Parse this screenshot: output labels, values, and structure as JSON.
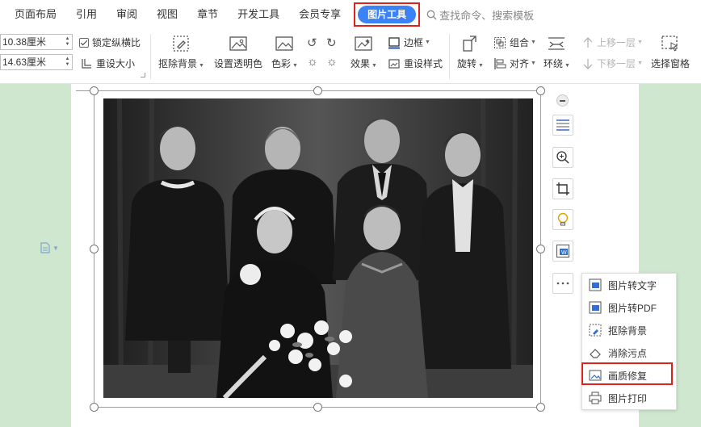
{
  "menu": {
    "items": [
      "页面布局",
      "引用",
      "审阅",
      "视图",
      "章节",
      "开发工具",
      "会员专享"
    ],
    "active_tab": "图片工具",
    "search_label": "查找命令、搜索模板"
  },
  "ribbon": {
    "width_value": "10.38厘米",
    "height_value": "14.63厘米",
    "lock_ratio_label": "锁定纵横比",
    "reset_size_label": "重设大小",
    "remove_bg_label": "抠除背景",
    "transparency_label": "设置透明色",
    "color_label": "色彩",
    "effects_label": "效果",
    "border_label": "边框",
    "reset_style_label": "重设样式",
    "rotate_label": "旋转",
    "group_label": "组合",
    "align_label": "对齐",
    "wrap_label": "环绕",
    "bring_forward_label": "上移一层",
    "send_backward_label": "下移一层",
    "selection_pane_label": "选择窗格"
  },
  "context_menu": {
    "items": [
      {
        "label": "图片转文字",
        "icon": "image-to-text-icon"
      },
      {
        "label": "图片转PDF",
        "icon": "image-to-pdf-icon"
      },
      {
        "label": "抠除背景",
        "icon": "remove-background-icon"
      },
      {
        "label": "消除污点",
        "icon": "eraser-icon"
      },
      {
        "label": "画质修复",
        "icon": "quality-repair-icon"
      },
      {
        "label": "图片打印",
        "icon": "printer-icon"
      }
    ]
  },
  "colors": {
    "accent": "#3b82f6",
    "highlight_border": "#e0201b",
    "workspace": "#cfe6cf"
  }
}
